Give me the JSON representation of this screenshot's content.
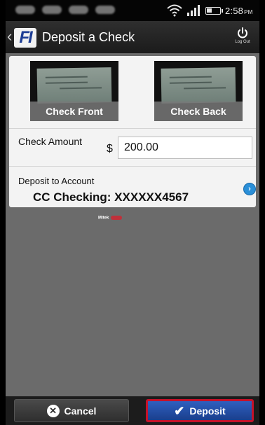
{
  "status_bar": {
    "time": "2:58",
    "ampm": "PM"
  },
  "header": {
    "title": "Deposit a Check",
    "logo_text": "FI",
    "logout_label": "Log Out"
  },
  "images": {
    "front_label": "Check Front",
    "back_label": "Check Back"
  },
  "amount": {
    "label": "Check Amount",
    "currency_symbol": "$",
    "value": "200.00"
  },
  "account": {
    "label": "Deposit to Account",
    "value": "CC Checking: XXXXXX4567"
  },
  "powered_by": {
    "brand": "Mitek"
  },
  "footer": {
    "cancel_label": "Cancel",
    "deposit_label": "Deposit"
  },
  "colors": {
    "accent": "#2a5bbf",
    "highlight": "#c4122a",
    "background": "#6b6b6b"
  }
}
